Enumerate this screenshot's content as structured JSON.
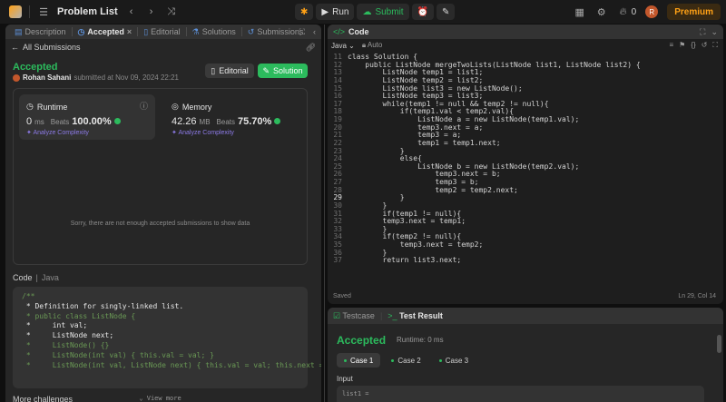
{
  "topbar": {
    "title": "Problem List",
    "run_label": "Run",
    "submit_label": "Submit",
    "streak": "0",
    "avatar_initial": "R",
    "premium_label": "Premium"
  },
  "left": {
    "tabs": [
      "Description",
      "Accepted",
      "Editorial",
      "Solutions",
      "Submissions"
    ],
    "back_label": "All Submissions",
    "status": "Accepted",
    "author": "Rohan Sahani",
    "submitted_text": "submitted at Nov 09, 2024 22:21",
    "editorial_label": "Editorial",
    "solution_label": "Solution",
    "runtime": {
      "label": "Runtime",
      "value": "0",
      "unit": "ms",
      "beats_label": "Beats",
      "pct": "100.00%",
      "analyze": "Analyze Complexity"
    },
    "memory": {
      "label": "Memory",
      "value": "42.26",
      "unit": "MB",
      "beats_label": "Beats",
      "pct": "75.70%",
      "analyze": "Analyze Complexity"
    },
    "empty_message": "Sorry, there are not enough accepted submissions to show data",
    "code_label": "Code",
    "code_lang": "Java",
    "code_lines": [
      "/**",
      " * Definition for singly-linked list.",
      " * public class ListNode {",
      " *     int val;",
      " *     ListNode next;",
      " *     ListNode() {}",
      " *     ListNode(int val) { this.val = val; }",
      " *     ListNode(int val, ListNode next) { this.val = val; this.next = next;"
    ],
    "view_more": "View more",
    "more_challenges": "More challenges"
  },
  "editor": {
    "tab_label": "Code",
    "language": "Java",
    "mode": "Auto",
    "lines": [
      {
        "n": "11",
        "t": "class Solution {"
      },
      {
        "n": "12",
        "t": "    public ListNode mergeTwoLists(ListNode list1, ListNode list2) {"
      },
      {
        "n": "13",
        "t": "        ListNode temp1 = list1;"
      },
      {
        "n": "14",
        "t": "        ListNode temp2 = list2;"
      },
      {
        "n": "15",
        "t": "        ListNode list3 = new ListNode();"
      },
      {
        "n": "16",
        "t": "        ListNode temp3 = list3;"
      },
      {
        "n": "17",
        "t": "        while(temp1 != null && temp2 != null){"
      },
      {
        "n": "18",
        "t": "            if(temp1.val < temp2.val){"
      },
      {
        "n": "19",
        "t": "                ListNode a = new ListNode(temp1.val);"
      },
      {
        "n": "20",
        "t": "                temp3.next = a;"
      },
      {
        "n": "21",
        "t": "                temp3 = a;"
      },
      {
        "n": "22",
        "t": "                temp1 = temp1.next;"
      },
      {
        "n": "23",
        "t": "            }"
      },
      {
        "n": "24",
        "t": "            else{"
      },
      {
        "n": "25",
        "t": "                ListNode b = new ListNode(temp2.val);"
      },
      {
        "n": "26",
        "t": "                    temp3.next = b;"
      },
      {
        "n": "27",
        "t": "                    temp3 = b;"
      },
      {
        "n": "28",
        "t": "                    temp2 = temp2.next;"
      },
      {
        "n": "29",
        "t": "            }"
      },
      {
        "n": "30",
        "t": "        }"
      },
      {
        "n": "31",
        "t": "        if(temp1 != null){"
      },
      {
        "n": "32",
        "t": "        temp3.next = temp1;"
      },
      {
        "n": "33",
        "t": "        }"
      },
      {
        "n": "34",
        "t": "        if(temp2 != null){"
      },
      {
        "n": "35",
        "t": "            temp3.next = temp2;"
      },
      {
        "n": "36",
        "t": "        }"
      },
      {
        "n": "37",
        "t": "        return list3.next;"
      }
    ],
    "current_line": "29",
    "saved_label": "Saved",
    "cursor_pos": "Ln 29, Col 14"
  },
  "tests": {
    "testcase_tab": "Testcase",
    "result_tab": "Test Result",
    "status": "Accepted",
    "runtime": "Runtime: 0 ms",
    "cases": [
      "Case 1",
      "Case 2",
      "Case 3"
    ],
    "input_label": "Input",
    "input_first": "list1 ="
  },
  "colors": {
    "accent_green": "#2cbb5d",
    "accent_orange": "#ffa116",
    "purple": "#8c7ae6"
  }
}
